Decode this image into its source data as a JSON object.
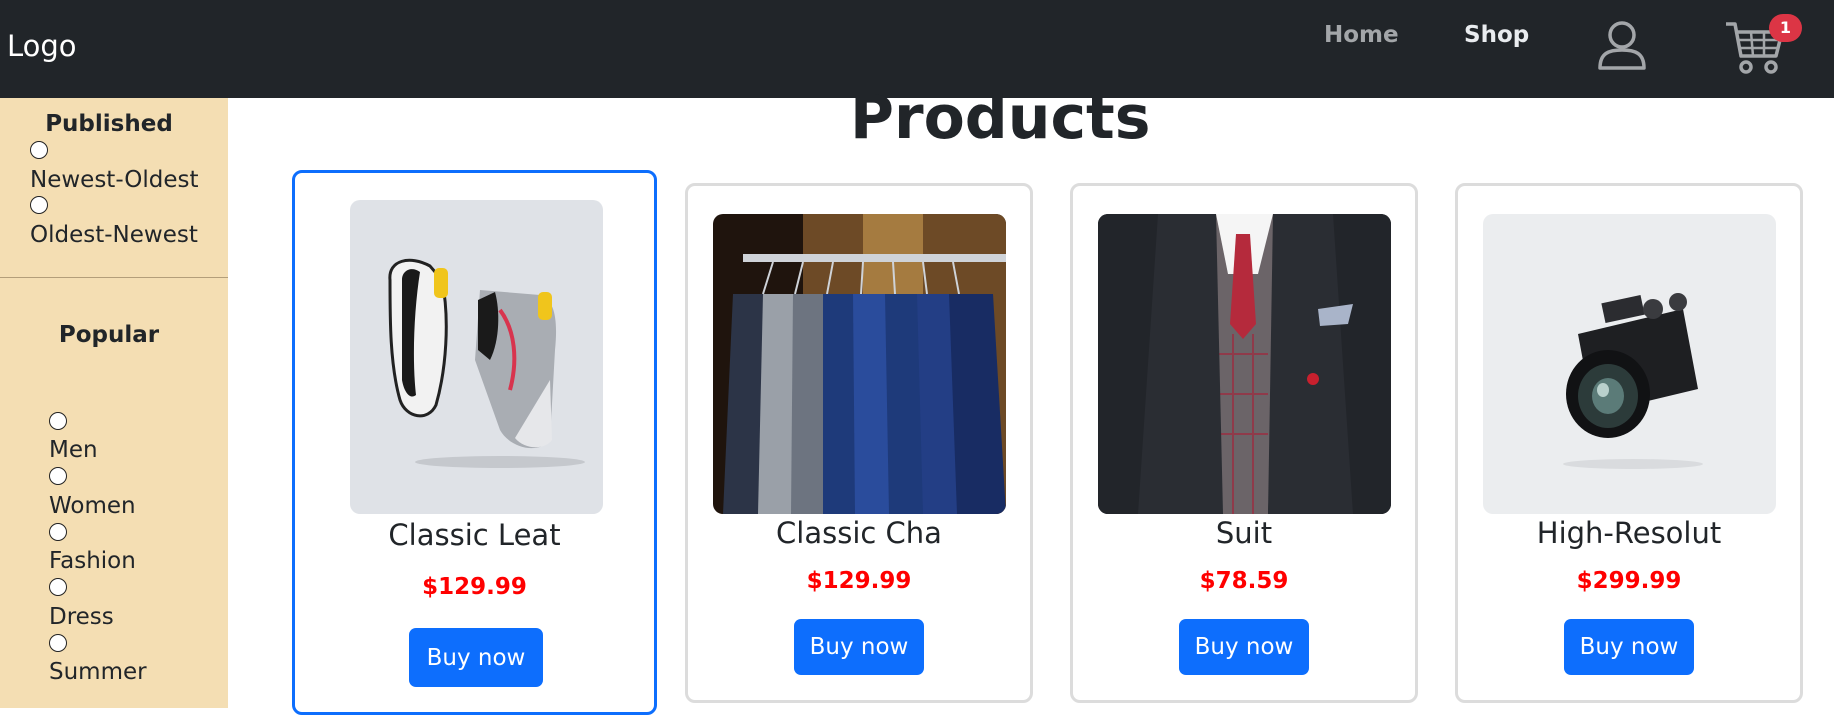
{
  "navbar": {
    "logo": "Logo",
    "links": [
      "Home",
      "Shop"
    ],
    "user_icon": "user-icon",
    "cart_icon": "cart-icon",
    "cart_count": "1",
    "colors": {
      "background": "#212529",
      "badge": "#dc3545"
    }
  },
  "sidebar": {
    "background": "#f4deb3",
    "published": {
      "heading": "Published",
      "options": [
        "Newest-Oldest",
        "Oldest-Newest"
      ]
    },
    "popular": {
      "heading": "Popular",
      "options": [
        "Men",
        "Women",
        "Fashion",
        "Dress",
        "Summer"
      ]
    }
  },
  "main": {
    "title": "Products",
    "products": [
      {
        "name": "Classic Leat",
        "price": "$129.99",
        "button": "Buy now",
        "image": "sneakers"
      },
      {
        "name": "Classic Cha",
        "price": "$129.99",
        "button": "Buy now",
        "image": "suits-on-rack"
      },
      {
        "name": "Suit",
        "price": "$78.59",
        "button": "Buy now",
        "image": "suit-jacket"
      },
      {
        "name": "High-Resolut",
        "price": "$299.99",
        "button": "Buy now",
        "image": "camera"
      }
    ],
    "colors": {
      "accent": "#0d6efd",
      "price": "#ff0000"
    }
  }
}
